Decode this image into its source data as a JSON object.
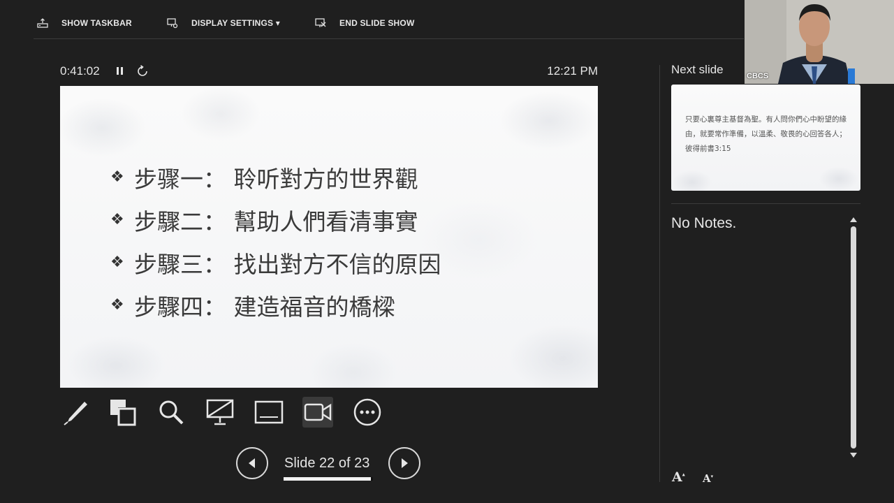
{
  "toolbar": {
    "show_taskbar": "SHOW TASKBAR",
    "display_settings": "DISPLAY SETTINGS ▾",
    "end_slide_show": "END SLIDE SHOW"
  },
  "timer": {
    "elapsed": "0:41:02",
    "clock": "12:21 PM"
  },
  "slide": {
    "bullet_glyph": "❖",
    "bullets": [
      "步骤一： 聆听對方的世界觀",
      "步驟二： 幫助人們看清事實",
      "步驟三： 找出對方不信的原因",
      "步驟四： 建造福音的橋樑"
    ]
  },
  "navigation": {
    "counter": "Slide 22 of 23",
    "current": 22,
    "total": 23
  },
  "next_slide": {
    "label": "Next slide",
    "text": "只要心裏尊主基督為聖。有人問你們心中盼望的緣由，就要常作準備，以溫柔、敬畏的心回答各人；彼得前書3:15"
  },
  "notes": {
    "text": "No Notes."
  },
  "font_controls": {
    "increase": "A",
    "decrease": "A"
  },
  "webcam": {
    "label": "CBCS"
  },
  "icons": [
    "taskbar-icon",
    "display-settings-icon",
    "end-show-icon",
    "pause-icon",
    "restart-icon",
    "pen-icon",
    "see-all-slides-icon",
    "zoom-icon",
    "black-screen-icon",
    "subtitles-icon",
    "camera-icon",
    "more-icon",
    "previous-icon",
    "next-icon"
  ]
}
